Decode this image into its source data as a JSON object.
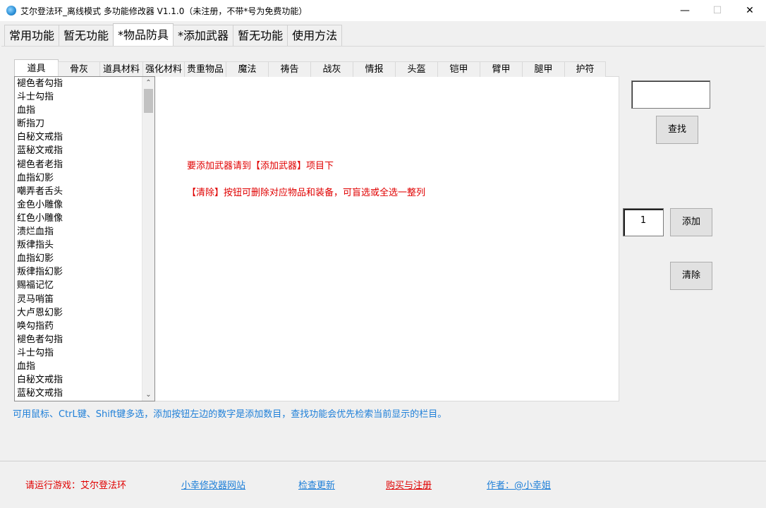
{
  "window": {
    "title": "艾尔登法环_离线模式 多功能修改器  V1.1.0（未注册，不带*号为免费功能）",
    "minimize": "—",
    "maximize": "☐",
    "close": "✕"
  },
  "main_tabs": [
    {
      "label": "常用功能",
      "active": false
    },
    {
      "label": "暂无功能",
      "active": false
    },
    {
      "label": "*物品防具",
      "active": true
    },
    {
      "label": "*添加武器",
      "active": false
    },
    {
      "label": "暂无功能",
      "active": false
    },
    {
      "label": "使用方法",
      "active": false
    }
  ],
  "sub_tabs": [
    {
      "label": "道具",
      "active": true
    },
    {
      "label": "骨灰",
      "active": false
    },
    {
      "label": "道具材料",
      "active": false
    },
    {
      "label": "强化材料",
      "active": false
    },
    {
      "label": "贵重物品",
      "active": false
    },
    {
      "label": "魔法",
      "active": false
    },
    {
      "label": "祷告",
      "active": false
    },
    {
      "label": "战灰",
      "active": false
    },
    {
      "label": "情报",
      "active": false
    },
    {
      "label": "头盔",
      "active": false
    },
    {
      "label": "铠甲",
      "active": false
    },
    {
      "label": "臂甲",
      "active": false
    },
    {
      "label": "腿甲",
      "active": false
    },
    {
      "label": "护符",
      "active": false
    }
  ],
  "items": [
    "褪色者勾指",
    "斗士勾指",
    "血指",
    "断指刀",
    "白秘文戒指",
    "蓝秘文戒指",
    "褪色者老指",
    "血指幻影",
    "嘲弄者舌头",
    "金色小雕像",
    "红色小雕像",
    "溃烂血指",
    "叛律指头",
    "血指幻影",
    "叛律指幻影",
    "赐福记忆",
    "灵马哨笛",
    "大卢恩幻影",
    "唤勾指药",
    "褪色者勾指",
    "斗士勾指",
    "血指",
    "白秘文戒指",
    "蓝秘文戒指"
  ],
  "scrollbar": {
    "up": "⌃",
    "down": "⌄"
  },
  "notes": {
    "weapon": "要添加武器请到【添加武器】项目下",
    "clear": "【清除】按钮可删除对应物品和装备，可盲选或全选一整列"
  },
  "search": {
    "value": "",
    "button": "查找"
  },
  "add": {
    "quantity": "1",
    "button": "添加"
  },
  "clear_button": "清除",
  "hint": "可用鼠标、CtrL键、Shift键多选，添加按钮左边的数字是添加数目，查找功能会优先检索当前显示的栏目。",
  "footer": {
    "game": "请运行游戏：艾尔登法环",
    "site": "小幸修改器网站",
    "update": "检查更新",
    "buy": "购买与注册",
    "author": "作者：@小幸姐"
  }
}
